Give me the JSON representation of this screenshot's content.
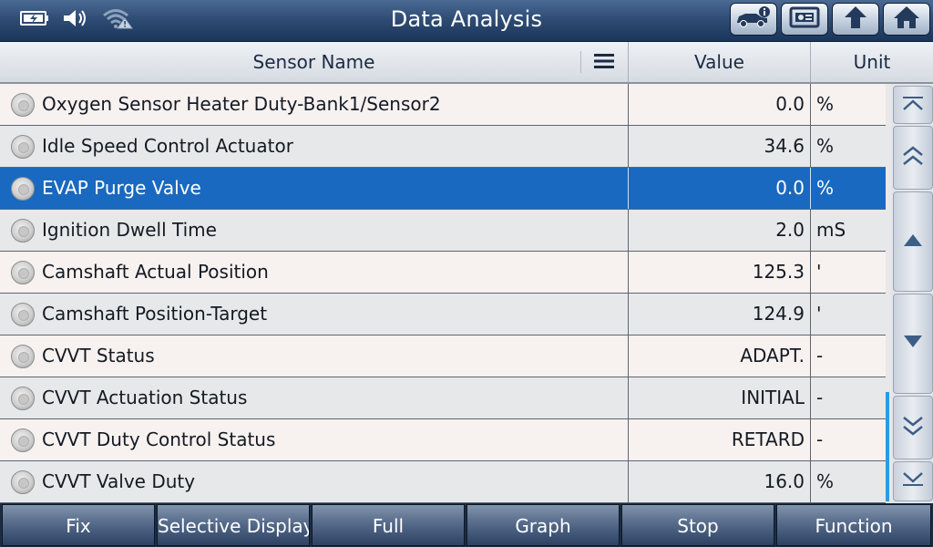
{
  "header": {
    "title": "Data Analysis",
    "status_icons": [
      "battery-charging-icon",
      "speaker-icon",
      "wifi-warning-icon"
    ],
    "toolbar_buttons": [
      "vehicle-info-icon",
      "report-icon",
      "back-arrow-icon",
      "home-icon"
    ]
  },
  "table": {
    "columns": {
      "name": "Sensor Name",
      "value": "Value",
      "unit": "Unit"
    },
    "rows": [
      {
        "name": "Oxygen Sensor Heater Duty-Bank1/Sensor2",
        "value": "0.0",
        "unit": "%"
      },
      {
        "name": "Idle Speed Control Actuator",
        "value": "34.6",
        "unit": "%"
      },
      {
        "name": "EVAP Purge Valve",
        "value": "0.0",
        "unit": "%",
        "selected": true
      },
      {
        "name": "Ignition Dwell Time",
        "value": "2.0",
        "unit": "mS"
      },
      {
        "name": "Camshaft Actual Position",
        "value": "125.3",
        "unit": "'"
      },
      {
        "name": "Camshaft Position-Target",
        "value": "124.9",
        "unit": "'"
      },
      {
        "name": "CVVT Status",
        "value": "ADAPT.",
        "unit": "-"
      },
      {
        "name": "CVVT Actuation Status",
        "value": "INITIAL",
        "unit": "-"
      },
      {
        "name": "CVVT Duty Control Status",
        "value": "RETARD",
        "unit": "-"
      },
      {
        "name": "CVVT Valve Duty",
        "value": "16.0",
        "unit": "%"
      }
    ]
  },
  "scroll_nav": [
    "scroll-top-icon",
    "page-up-icon",
    "line-up-icon",
    "line-down-icon",
    "page-down-icon",
    "scroll-bottom-icon"
  ],
  "footer": {
    "buttons": [
      "Fix",
      "Selective Display",
      "Full",
      "Graph",
      "Stop",
      "Function"
    ]
  },
  "colors": {
    "selected_row": "#1969c0",
    "title_bar": "#2f4d75",
    "scroll_thumb": "#2a9de0"
  }
}
